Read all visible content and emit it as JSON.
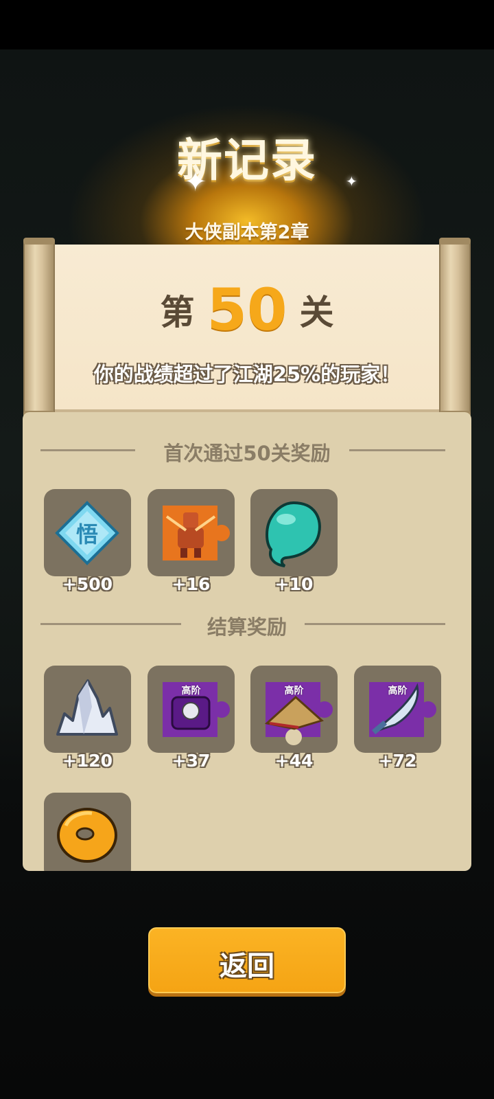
{
  "header": {
    "title": "新记录",
    "subtitle": "大侠副本第2章"
  },
  "scroll": {
    "stage_prefix": "第",
    "stage_number": "50",
    "stage_suffix": "关",
    "beat_text": "你的战绩超过了江湖25%的玩家！"
  },
  "first_clear": {
    "heading": "首次通过50关奖励",
    "items": [
      {
        "icon": "wu-diamond-icon",
        "count": "+500"
      },
      {
        "icon": "orange-hero-puzzle-icon",
        "count": "+16"
      },
      {
        "icon": "teal-orb-icon",
        "count": "+10"
      }
    ]
  },
  "settlement": {
    "heading": "结算奖励",
    "items": [
      {
        "icon": "silver-crystal-icon",
        "count": "+120"
      },
      {
        "icon": "purple-armor-puzzle-icon",
        "count": "+37",
        "badge": "高阶"
      },
      {
        "icon": "purple-hat-puzzle-icon",
        "count": "+44",
        "badge": "高阶"
      },
      {
        "icon": "purple-sword-puzzle-icon",
        "count": "+72",
        "badge": "高阶"
      },
      {
        "icon": "gold-ring-coin-icon"
      }
    ]
  },
  "footer": {
    "back_label": "返回"
  },
  "colors": {
    "accent": "#f6a81a",
    "panel": "#ded0ad",
    "slot": "#7c7260",
    "rare_purple": "#7b2fa8"
  }
}
